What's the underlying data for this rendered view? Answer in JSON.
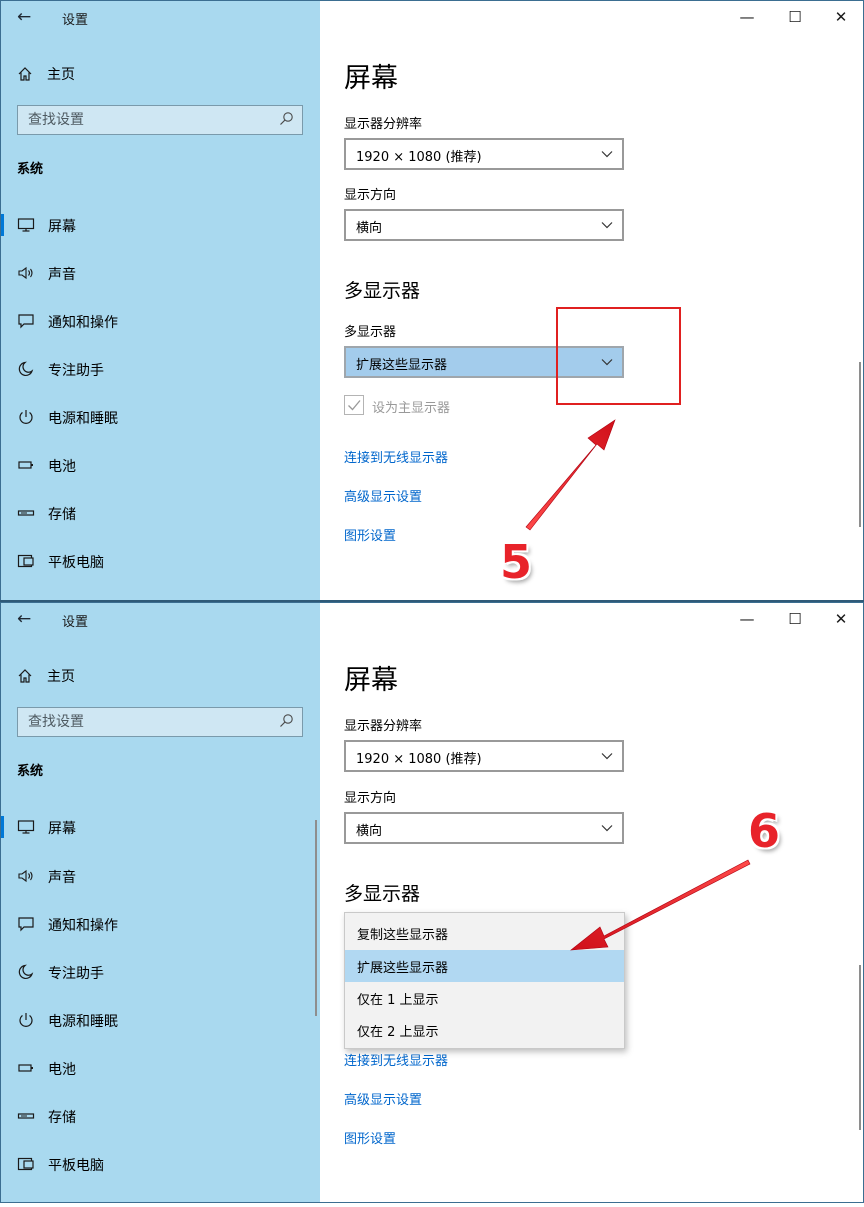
{
  "window": {
    "title": "设置",
    "back_icon": "←",
    "minimize_icon": "—",
    "maximize_icon": "☐",
    "close_icon": "✕"
  },
  "sidebar": {
    "home_label": "主页",
    "search_placeholder": "查找设置",
    "section_label": "系统",
    "items": [
      {
        "label": "屏幕",
        "icon": "monitor-icon"
      },
      {
        "label": "声音",
        "icon": "speaker-icon"
      },
      {
        "label": "通知和操作",
        "icon": "message-icon"
      },
      {
        "label": "专注助手",
        "icon": "moon-icon"
      },
      {
        "label": "电源和睡眠",
        "icon": "power-icon"
      },
      {
        "label": "电池",
        "icon": "battery-icon"
      },
      {
        "label": "存储",
        "icon": "storage-icon"
      },
      {
        "label": "平板电脑",
        "icon": "tablet-icon"
      }
    ]
  },
  "main": {
    "page_title": "屏幕",
    "resolution_label": "显示器分辨率",
    "resolution_value": "1920 × 1080 (推荐)",
    "orientation_label": "显示方向",
    "orientation_value": "横向",
    "multi_title": "多显示器",
    "multi_label": "多显示器",
    "multi_value": "扩展这些显示器",
    "primary_checkbox_label": "设为主显示器",
    "links": [
      "连接到无线显示器",
      "高级显示设置",
      "图形设置"
    ]
  },
  "dropdown_menu": {
    "options": [
      "复制这些显示器",
      "扩展这些显示器",
      "仅在 1 上显示",
      "仅在 2 上显示"
    ],
    "selected_index": 1
  },
  "annotations": {
    "step1": "5",
    "step2": "6"
  },
  "colors": {
    "sidebar_bg": "#a9d9ef",
    "accent": "#0078d7",
    "link": "#0066cc",
    "annotation": "#e8232a"
  }
}
